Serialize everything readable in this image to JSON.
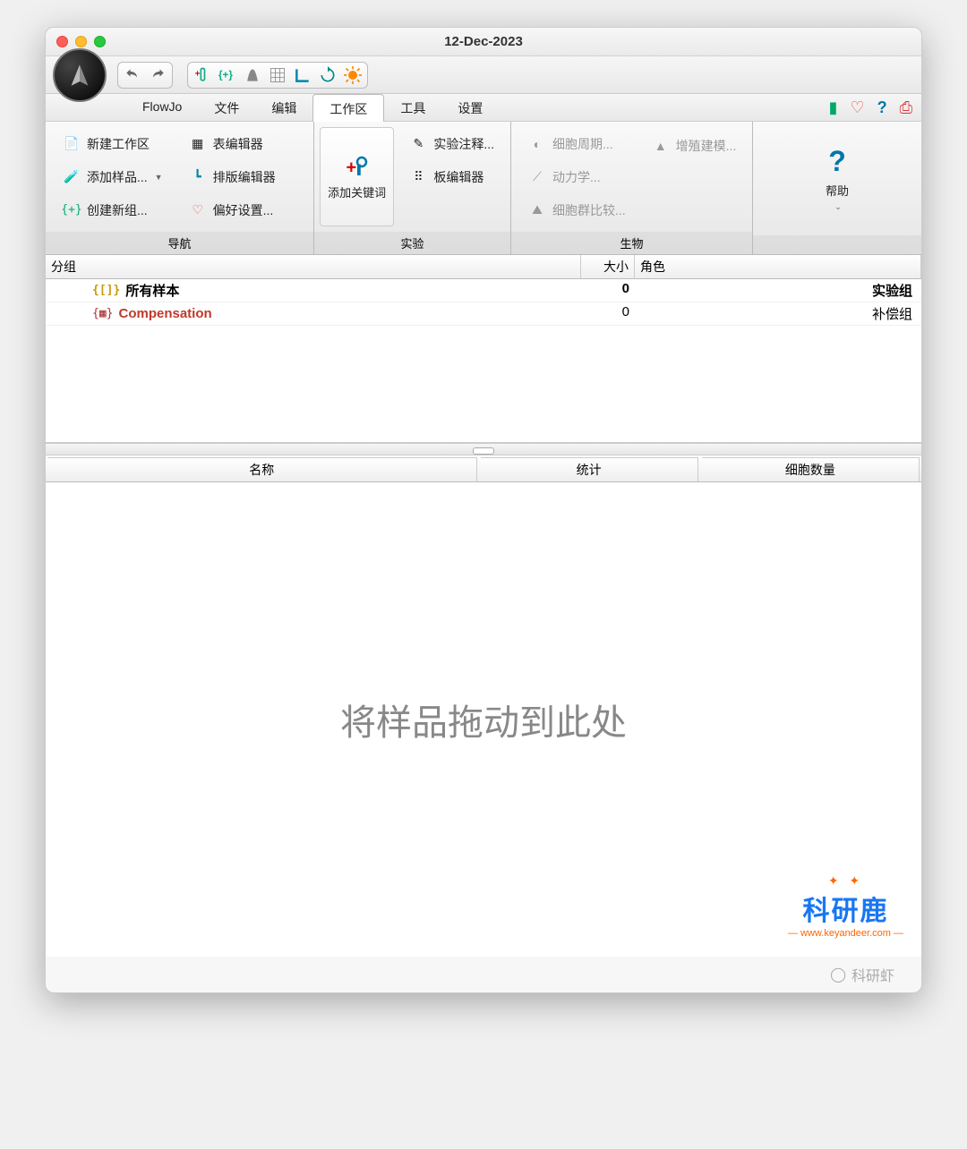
{
  "window": {
    "title": "12-Dec-2023"
  },
  "menubar": {
    "items": [
      "FlowJo",
      "文件",
      "编辑",
      "工作区",
      "工具",
      "设置"
    ]
  },
  "ribbon": {
    "groups": {
      "nav": {
        "label": "导航",
        "items": [
          "新建工作区",
          "添加样品...",
          "创建新组...",
          "表编辑器",
          "排版编辑器",
          "偏好设置..."
        ]
      },
      "exp": {
        "label": "实验",
        "add_keyword": "添加关键词",
        "items": [
          "实验注释...",
          "板编辑器"
        ]
      },
      "bio": {
        "label": "生物",
        "items": [
          "细胞周期...",
          "动力学...",
          "细胞群比较...",
          "增殖建模..."
        ]
      },
      "help": {
        "label": "帮助"
      }
    }
  },
  "group_table": {
    "headers": [
      "分组",
      "大小",
      "角色"
    ],
    "rows": [
      {
        "name": "所有样本",
        "size": "0",
        "role": "实验组",
        "style": "bold"
      },
      {
        "name": "Compensation",
        "size": "0",
        "role": "补偿组",
        "style": "comp"
      }
    ]
  },
  "sample_table": {
    "headers": [
      "名称",
      "统计",
      "细胞数量"
    ],
    "placeholder": "将样品拖动到此处"
  },
  "watermark": {
    "title": "科研鹿",
    "url": "www.keyandeer.com"
  },
  "footer": {
    "text": "科研虾"
  }
}
